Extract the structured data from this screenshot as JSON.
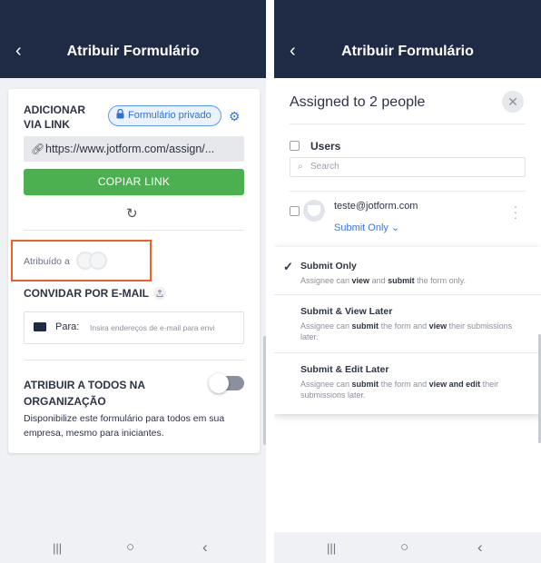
{
  "left_screen": {
    "header": {
      "title": "Atribuir Formulário",
      "back_glyph": "‹"
    },
    "link_section": {
      "title_line1": "ADICIONAR",
      "title_line2": "VIA LINK",
      "privacy_badge": "Formulário privado",
      "url": "https://www.jotform.com/assign/...",
      "copy_button": "COPIAR LINK"
    },
    "assigned_label": "Atribuído a",
    "invite_section": {
      "title": "CONVIDAR POR E-MAIL",
      "to_label": "Para:",
      "placeholder": "Insira endereços de e-mail para envi"
    },
    "org_section": {
      "title_line1": "ATRIBUIR A TODOS NA",
      "title_line2": "ORGANIZAÇÃO",
      "description": "Disponibilize este formulário para todos em sua empresa, mesmo para iniciantes.",
      "toggle_on": false
    }
  },
  "right_screen": {
    "header": {
      "title": "Atribuir Formulário",
      "back_glyph": "‹"
    },
    "modal": {
      "title": "Assigned to 2 people",
      "users_label": "Users",
      "search_placeholder": "Search",
      "user_email": "teste@jotform.com",
      "user_role": "Submit Only ⌄"
    },
    "role_options": [
      {
        "name": "Submit Only",
        "desc_a": "Assignee can ",
        "desc_b": "view",
        "desc_c": " and ",
        "desc_d": "submit",
        "desc_e": " the form only.",
        "selected": true
      },
      {
        "name": "Submit & View Later",
        "desc_a": "Assignee can ",
        "desc_b": "submit",
        "desc_c": " the form and ",
        "desc_d": "view",
        "desc_e": " their submissions later.",
        "selected": false
      },
      {
        "name": "Submit & Edit Later",
        "desc_a": "Assignee can ",
        "desc_b": "submit",
        "desc_c": " the form and ",
        "desc_d": "view and edit",
        "desc_e": " their submissions later.",
        "selected": false
      }
    ]
  },
  "colors": {
    "header_bg": "#1f2a44",
    "accent_blue": "#3777e4",
    "button_green": "#4caf50",
    "highlight_orange": "#e8632b"
  }
}
